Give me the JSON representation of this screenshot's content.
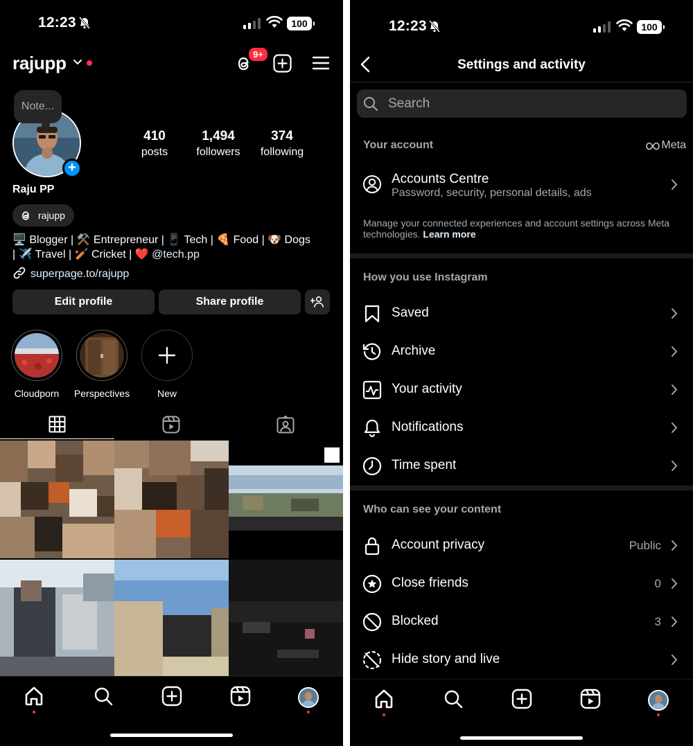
{
  "status_bar": {
    "time": "12:23",
    "battery": "100"
  },
  "profile": {
    "username": "rajupp",
    "notification_badge": "9+",
    "note_placeholder": "Note...",
    "full_name": "Raju PP",
    "threads_handle": "rajupp",
    "stats": [
      {
        "value": "410",
        "label": "posts"
      },
      {
        "value": "1,494",
        "label": "followers"
      },
      {
        "value": "374",
        "label": "following"
      }
    ],
    "bio_line1": "🖥️ Blogger | ⚒️ Entrepreneur | 📱 Tech | 🍕 Food | 🐶 Dogs",
    "bio_line2_prefix": "| ✈️ Travel | 🏏 Cricket | ❤️ ",
    "bio_mention": "@tech.pp",
    "link": "superpage.to/rajupp",
    "edit_button": "Edit profile",
    "share_button": "Share profile",
    "highlights": [
      {
        "label": "Cloudporn"
      },
      {
        "label": "Perspectives"
      },
      {
        "label": "New"
      }
    ]
  },
  "settings": {
    "title": "Settings and activity",
    "search_placeholder": "Search",
    "your_account_header": "Your account",
    "meta_label": "Meta",
    "accounts_centre_title": "Accounts Centre",
    "accounts_centre_subtitle": "Password, security, personal details, ads",
    "accounts_centre_desc": "Manage your connected experiences and account settings across Meta technologies.",
    "learn_more": "Learn more",
    "how_you_use_header": "How you use Instagram",
    "how_you_use_items": [
      {
        "label": "Saved",
        "icon": "bookmark-icon"
      },
      {
        "label": "Archive",
        "icon": "archive-icon"
      },
      {
        "label": "Your activity",
        "icon": "activity-icon"
      },
      {
        "label": "Notifications",
        "icon": "bell-icon"
      },
      {
        "label": "Time spent",
        "icon": "clock-icon"
      }
    ],
    "who_can_see_header": "Who can see your content",
    "who_can_see_items": [
      {
        "label": "Account privacy",
        "value": "Public",
        "icon": "lock-icon"
      },
      {
        "label": "Close friends",
        "value": "0",
        "icon": "star-icon"
      },
      {
        "label": "Blocked",
        "value": "3",
        "icon": "blocked-icon"
      },
      {
        "label": "Hide story and live",
        "value": "",
        "icon": "hide-story-icon"
      }
    ]
  },
  "colors": {
    "accent_blue": "#0095f6",
    "badge_red": "#ff2d3f",
    "background": "#000000",
    "surface": "#262626"
  }
}
